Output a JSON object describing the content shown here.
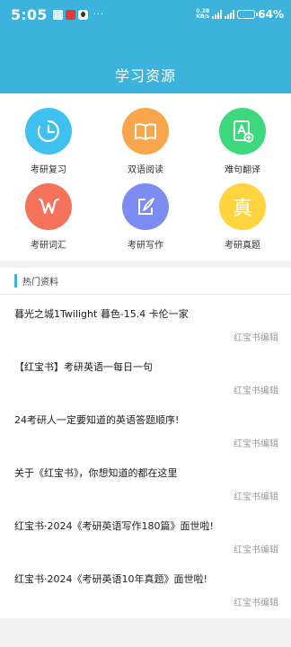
{
  "status_bar": {
    "time": "5:05",
    "dots": "···",
    "net_speed_value": "0.28",
    "net_speed_unit": "KB/s",
    "battery_percent": "64",
    "battery_suffix": "%",
    "battery_level": 0.64,
    "icons": [
      "gallery-notification-icon",
      "app-notification-icon",
      "qq-notification-icon",
      "signal-icon",
      "signal-icon",
      "battery-icon"
    ]
  },
  "header": {
    "title": "学习资源"
  },
  "grid": [
    {
      "label": "考研复习",
      "icon": "clock-icon",
      "color": "#3ec1ef"
    },
    {
      "label": "双语阅读",
      "icon": "book-icon",
      "color": "#f9a54b"
    },
    {
      "label": "难句翻译",
      "icon": "translate-icon",
      "color": "#3dd87c"
    },
    {
      "label": "考研词汇",
      "icon": "letter-w-icon",
      "color": "#f4735a"
    },
    {
      "label": "考研写作",
      "icon": "pen-icon",
      "color": "#7d8cf2"
    },
    {
      "label": "考研真题",
      "icon_text": "真",
      "icon": "real-exam-icon",
      "color": "#ffd43f"
    }
  ],
  "hot_section": {
    "title": "热门资料"
  },
  "articles": [
    {
      "title": "暮光之城1Twilight 暮色-15.4 卡伦一家",
      "author": "红宝书编辑"
    },
    {
      "title": "【红宝书】考研英语一每日一句",
      "author": "红宝书编辑"
    },
    {
      "title": "24考研人一定要知道的英语答题顺序!",
      "author": "红宝书编辑"
    },
    {
      "title": "关于《红宝书》，你想知道的都在这里",
      "author": "红宝书编辑"
    },
    {
      "title": "红宝书·2024《考研英语写作180篇》面世啦!",
      "author": "红宝书编辑"
    },
    {
      "title": "红宝书·2024《考研英语10年真题》面世啦!",
      "author": "红宝书编辑"
    }
  ],
  "colors": {
    "brand": "#3cb3dc",
    "background": "#f1f1f1"
  }
}
